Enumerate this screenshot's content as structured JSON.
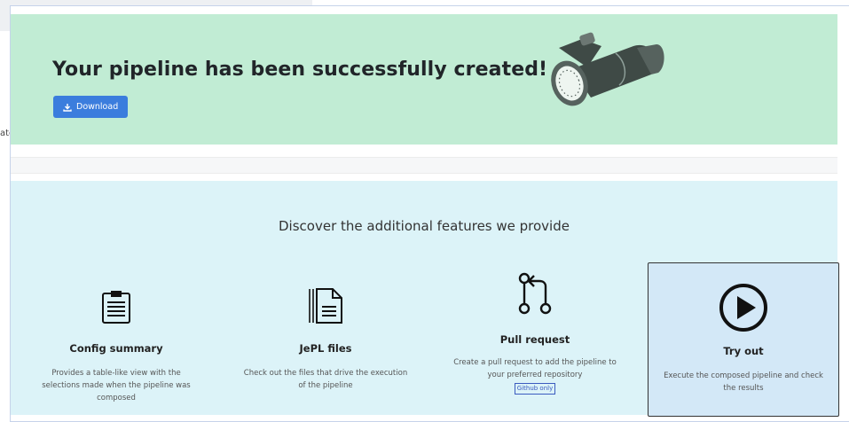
{
  "background": {
    "edge_text": "atc"
  },
  "success": {
    "title": "Your pipeline has been successfully created!",
    "download_label": "Download",
    "bg_color": "#c1ecd4",
    "button_color": "#3b7ddd"
  },
  "features": {
    "title": "Discover the additional features we provide",
    "bg_color": "#dcf3f8",
    "items": [
      {
        "icon": "clipboard-list-icon",
        "title": "Config summary",
        "description": "Provides a table-like view with the selections made when the pipeline was composed"
      },
      {
        "icon": "document-files-icon",
        "title": "JePL files",
        "description": "Check out the files that drive the execution of the pipeline"
      },
      {
        "icon": "git-pull-request-icon",
        "title": "Pull request",
        "description": "Create a pull request to add the pipeline to your preferred repository",
        "badge": "Github only"
      },
      {
        "icon": "play-circle-icon",
        "title": "Try out",
        "description": "Execute the composed pipeline and check the results",
        "selected": true
      }
    ]
  }
}
